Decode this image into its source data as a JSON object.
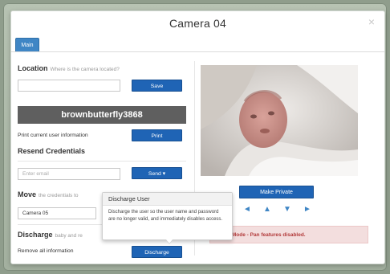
{
  "modal": {
    "title": "Camera 04",
    "close": "×",
    "tab_main": "Main"
  },
  "location": {
    "header": "Location",
    "subheader": "Where is the camera located?",
    "input_value": "",
    "save_label": "Save"
  },
  "user": {
    "username": "brownbutterfly3868",
    "print_text": "Print current user information",
    "print_label": "Print"
  },
  "resend": {
    "header": "Resend Credentials",
    "email_placeholder": "Enter email",
    "send_label": "Send ▾"
  },
  "move": {
    "header": "Move",
    "subheader": "the credentials to",
    "select_value": "Camera 05"
  },
  "discharge": {
    "header": "Discharge",
    "subheader": "baby and re",
    "remove_text": "Remove all information",
    "button_label": "Discharge"
  },
  "popover": {
    "title": "Discharge User",
    "body": "Discharge the user so the user name and password are no longer valid, and immediately disables access."
  },
  "camera": {
    "make_private_label": "Make Private",
    "demo_message": "Demo Mode - Pan features disabled.",
    "arrows": [
      "◄",
      "▲",
      "▼",
      "►"
    ]
  },
  "colors": {
    "primary_button": "#1f64b5",
    "tab": "#3f86c5",
    "username_bar": "#5f5f5f",
    "alert_bg": "#f3dede",
    "alert_text": "#b23a3a"
  }
}
